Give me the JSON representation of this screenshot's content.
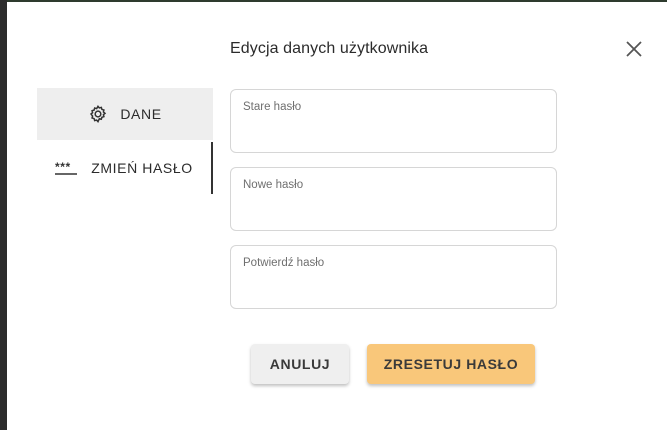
{
  "dialog": {
    "title": "Edycja danych użytkownika"
  },
  "nav": {
    "items": [
      {
        "label": "DANE",
        "icon": "gear-icon"
      },
      {
        "label": "ZMIEŃ HASŁO",
        "icon": "password-icon"
      }
    ]
  },
  "form": {
    "fields": [
      {
        "label": "Stare hasło",
        "value": ""
      },
      {
        "label": "Nowe hasło",
        "value": ""
      },
      {
        "label": "Potwierdź hasło",
        "value": ""
      }
    ]
  },
  "actions": {
    "cancel_label": "ANULUJ",
    "reset_label": "ZRESETUJ HASŁO"
  },
  "colors": {
    "primary_button": "#f9c77a",
    "secondary_button": "#efefef",
    "active_nav_bg": "#eeeeee"
  }
}
